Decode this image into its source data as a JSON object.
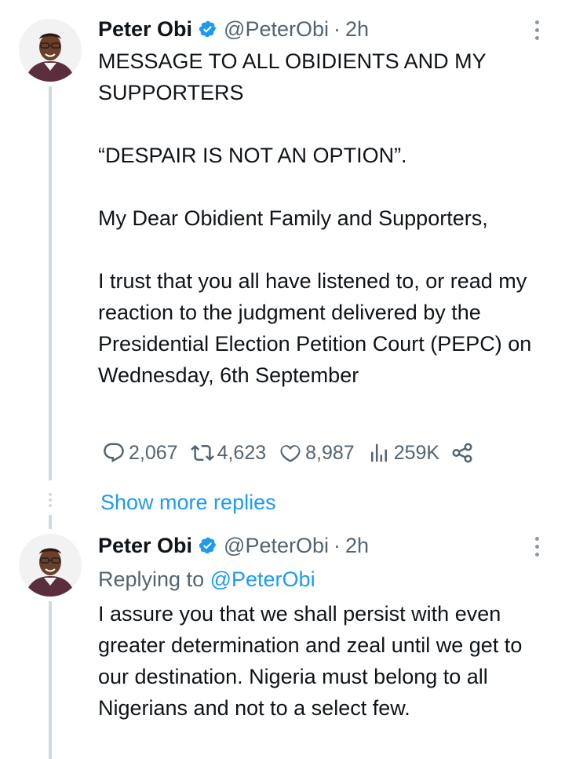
{
  "tweet_main": {
    "author_name": "Peter Obi",
    "handle": "@PeterObi",
    "separator": "·",
    "time": "2h",
    "lines": [
      "MESSAGE TO ALL OBIDIENTS AND MY SUPPORTERS",
      "“DESPAIR IS NOT AN OPTION”.",
      "My Dear Obidient Family and Supporters,",
      "I trust that you all have listened to, or read my reaction to the judgment delivered by the Presidential  Election Petition Court (PEPC) on Wednesday, 6th September"
    ],
    "metrics": {
      "replies": "2,067",
      "retweets": "4,623",
      "likes": "8,987",
      "views": "259K"
    }
  },
  "show_more": "Show more replies",
  "tweet_reply": {
    "author_name": "Peter Obi",
    "handle": "@PeterObi",
    "separator": "·",
    "time": "2h",
    "replying_prefix": "Replying to",
    "replying_handle": "@PeterObi",
    "text": "I assure you that we shall persist with even greater determination and zeal until we get to our destination. Nigeria must belong to all Nigerians and not to a select few."
  },
  "colors": {
    "link": "#1d9bf0",
    "secondary_text": "#536471",
    "thread_line": "#cfd9de",
    "verified": "#1d9bf0"
  },
  "icons": [
    "reply-icon",
    "retweet-icon",
    "like-icon",
    "views-icon",
    "share-icon",
    "verified-badge-icon",
    "more-options-icon"
  ]
}
